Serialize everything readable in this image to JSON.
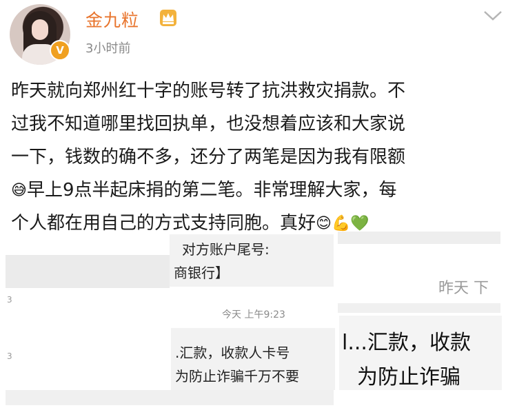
{
  "header": {
    "username": "金九粒",
    "time_ago": "3小时前",
    "verified_badge": "V",
    "avatar_icon": "avatar-photo",
    "crown_icon": "crown-icon",
    "menu_icon": "chevron-down-icon",
    "username_color": "#e8742c"
  },
  "post": {
    "lines": [
      "昨天就向郑州红十字的账号转了抗洪救灾捐款。不",
      "过我不知道哪里找回执单，也没想着应该和大家说",
      "一下，钱数的确不多，还分了两笔是因为我有限额",
      "早上9点半起床捐的第二笔。非常理解大家，每",
      "个人都在用自己的方式支持同胞。真好"
    ],
    "emoji_sweat": "😅",
    "emoji_smile": "😊",
    "emoji_muscle": "💪",
    "emoji_heart": "💚"
  },
  "images": {
    "snip1_line1": "对方账户尾号:",
    "snip1_line2": "商银行】",
    "yesterday_label": "昨天 下",
    "chat_time": "今天 上午9:23",
    "snip2_line1": ".汇款，收款人卡号",
    "snip2_line2": "为防止诈骗千万不要",
    "snip3_line1": "l...汇款，收款",
    "snip3_line2": "为防止诈骗"
  }
}
